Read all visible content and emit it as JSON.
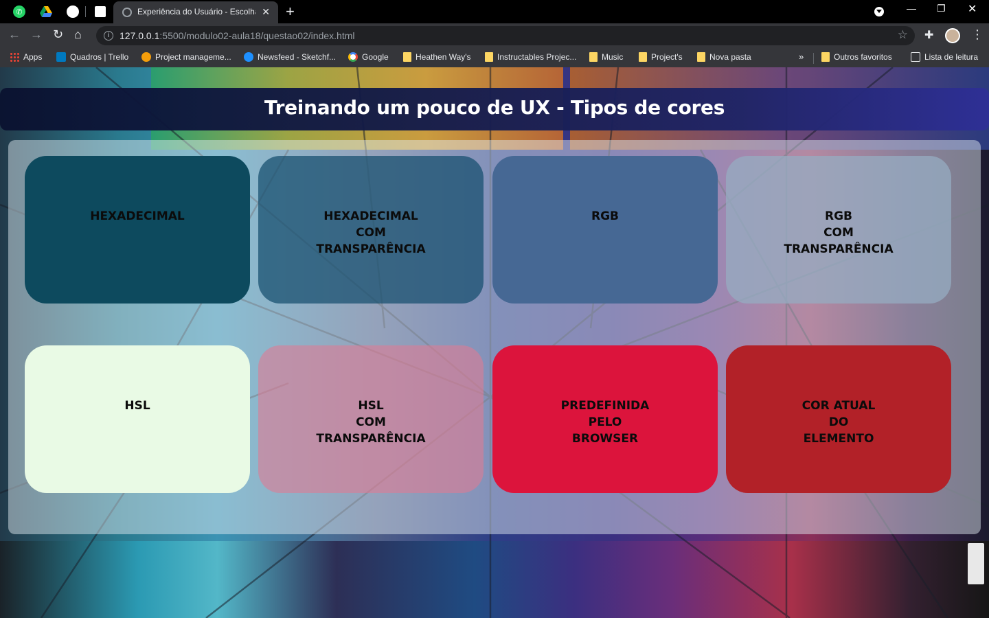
{
  "browser": {
    "tab_title": "Experiência do Usuário - Escolha",
    "url_host": "127.0.0.1",
    "url_rest": ":5500/modulo02-aula18/questao02/index.html",
    "bookmarks": [
      {
        "label": "Apps",
        "icon": "apps-grid-icon"
      },
      {
        "label": "Quadros | Trello",
        "icon": "trello-icon"
      },
      {
        "label": "Project manageme...",
        "icon": "h-icon"
      },
      {
        "label": "Newsfeed - Sketchf...",
        "icon": "sketchfab-icon"
      },
      {
        "label": "Google",
        "icon": "google-icon"
      },
      {
        "label": "Heathen Way's",
        "icon": "folder-icon"
      },
      {
        "label": "Instructables Projec...",
        "icon": "folder-icon"
      },
      {
        "label": "Music",
        "icon": "folder-icon"
      },
      {
        "label": "Project's",
        "icon": "folder-icon"
      },
      {
        "label": "Nova pasta",
        "icon": "folder-icon"
      },
      {
        "label": "Outros favoritos",
        "icon": "folder-icon"
      },
      {
        "label": "Lista de leitura",
        "icon": "reading-list-icon"
      }
    ],
    "overflow_label": "»"
  },
  "page": {
    "title": "Treinando um pouco de UX - Tipos de cores",
    "cards": [
      {
        "label": "HEXADECIMAL",
        "color": "#0d4a5e"
      },
      {
        "label": "HEXADECIMAL\nCOM\nTRANSPARÊNCIA",
        "color": "#154e6eb8"
      },
      {
        "label": "RGB",
        "color": "rgb(70, 104, 148)"
      },
      {
        "label": "RGB\nCOM\nTRANSPARÊNCIA",
        "color": "rgba(150, 172, 194, 0.75)"
      },
      {
        "label": "HSL",
        "color": "hsl(110, 70%, 94%)"
      },
      {
        "label": "HSL\nCOM\nTRANSPARÊNCIA",
        "color": "hsla(345, 60%, 68%, 0.6)"
      },
      {
        "label": "PREDEFINIDA\nPELO\nBROWSER",
        "color": "crimson"
      },
      {
        "label": "COR ATUAL\nDO\nELEMENTO",
        "color": "#b22128"
      }
    ]
  }
}
